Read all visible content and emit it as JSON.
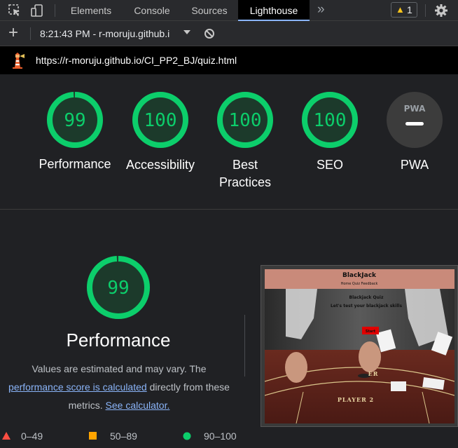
{
  "colors": {
    "pass": "#0cce6b",
    "average": "#ffa400",
    "fail": "#ff4e42",
    "link": "#8ab4f8",
    "background": "#202124"
  },
  "tabs": {
    "items": [
      {
        "label": "Elements"
      },
      {
        "label": "Console"
      },
      {
        "label": "Sources"
      },
      {
        "label": "Lighthouse"
      }
    ],
    "active": "Lighthouse",
    "more_icon": "chevron-double-right-icon",
    "warning_count": "1"
  },
  "toolbar": {
    "report_label": "8:21:43 PM - r-moruju.github.i",
    "icons": [
      "plus-icon",
      "chevron-down-icon",
      "clear-icon"
    ]
  },
  "url": "https://r-moruju.github.io/CI_PP2_BJ/quiz.html",
  "gauges": [
    {
      "score": "99",
      "label": "Performance",
      "value": 0.99
    },
    {
      "score": "100",
      "label": "Accessibility",
      "value": 1.0
    },
    {
      "score": "100",
      "label": "Best Practices",
      "value": 1.0
    },
    {
      "score": "100",
      "label": "SEO",
      "value": 1.0
    },
    {
      "badge": "PWA",
      "label": "PWA"
    }
  ],
  "performance": {
    "score": "99",
    "value": 0.99,
    "title": "Performance",
    "desc_1": "Values are estimated and may vary. The",
    "link_score": "performance score is calculated",
    "desc_2": "directly from these",
    "desc_3": "metrics.",
    "link_calc": "See calculator."
  },
  "legend": [
    {
      "range": "0–49",
      "shape": "triangle"
    },
    {
      "range": "50–89",
      "shape": "square"
    },
    {
      "range": "90–100",
      "shape": "circle"
    }
  ],
  "thumbnail": {
    "site_title": "BlackJack",
    "nav": "Home   Quiz   Feedback",
    "quiz_title": "Blackjack Quiz",
    "subtitle": "Let's test your blackjack skills",
    "start_button": "Start",
    "table_text_1": "ER",
    "table_text_2": "PLAYER 2"
  }
}
